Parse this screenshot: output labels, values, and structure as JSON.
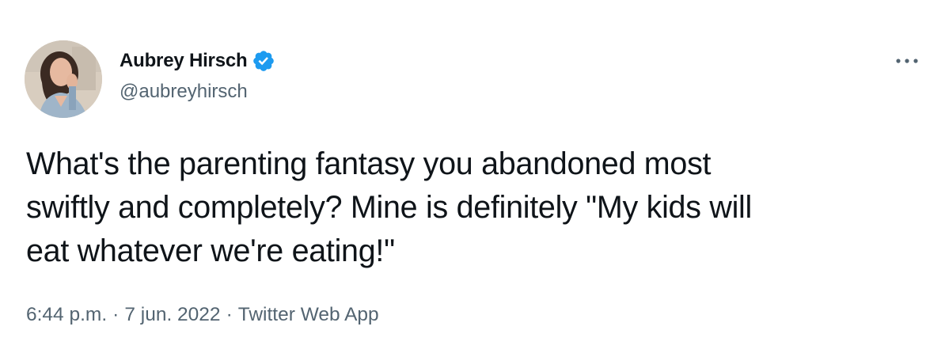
{
  "author": {
    "display_name": "Aubrey Hirsch",
    "handle": "@aubreyhirsch",
    "verified": true,
    "verified_color": "#1d9bf0"
  },
  "tweet": {
    "text": "What's the parenting fantasy you abandoned most\nswiftly and completely? Mine is definitely \"My kids will\neat whatever we're eating!\""
  },
  "meta": {
    "time": "6:44 p.m.",
    "separator": "·",
    "date": "7 jun. 2022",
    "source": "Twitter Web App"
  },
  "icons": {
    "more": "more-horizontal-icon",
    "verified": "verified-badge-icon"
  },
  "colors": {
    "text_primary": "#0f1419",
    "text_secondary": "#536471",
    "background": "#ffffff"
  }
}
